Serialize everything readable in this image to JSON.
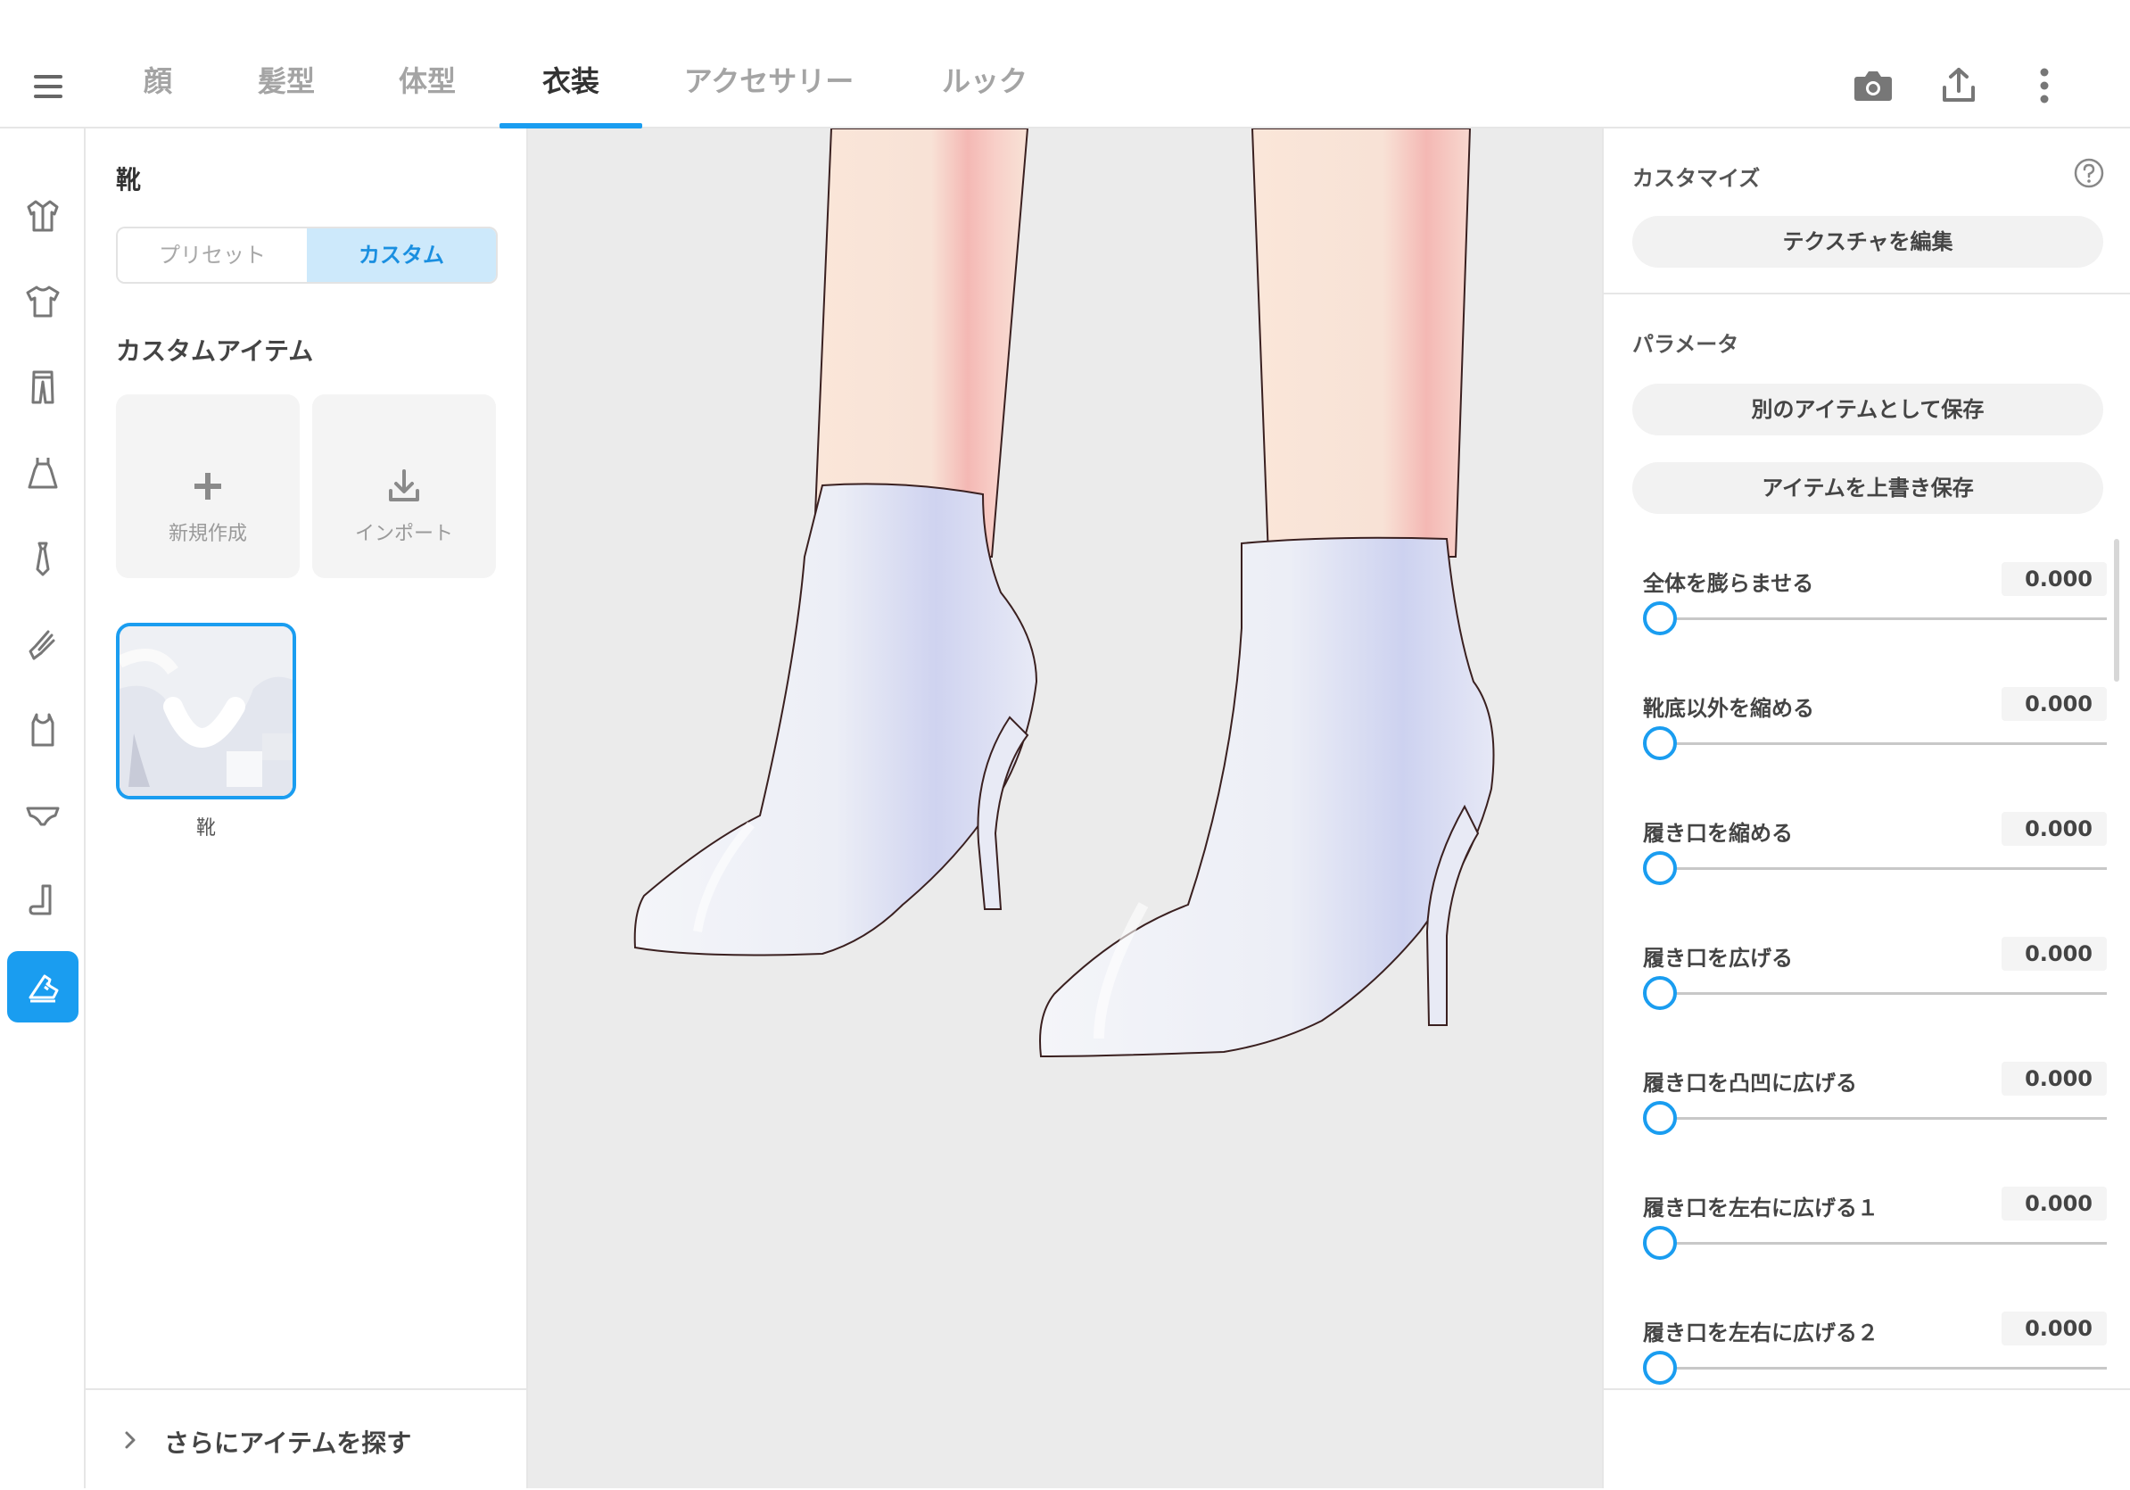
{
  "tabs": [
    {
      "label": "顔",
      "active": false
    },
    {
      "label": "髪型",
      "active": false
    },
    {
      "label": "体型",
      "active": false
    },
    {
      "label": "衣装",
      "active": true
    },
    {
      "label": "アクセサリー",
      "active": false
    },
    {
      "label": "ルック",
      "active": false
    }
  ],
  "top_icons": [
    "camera-icon",
    "share-upload-icon",
    "more-vertical-icon"
  ],
  "rail_items": [
    {
      "icon": "jacket-icon",
      "active": false
    },
    {
      "icon": "tshirt-icon",
      "active": false
    },
    {
      "icon": "pants-icon",
      "active": false
    },
    {
      "icon": "dress-icon",
      "active": false
    },
    {
      "icon": "necktie-icon",
      "active": false
    },
    {
      "icon": "glove-icon",
      "active": false
    },
    {
      "icon": "tank-top-icon",
      "active": false
    },
    {
      "icon": "underwear-icon",
      "active": false
    },
    {
      "icon": "sock-icon",
      "active": false
    },
    {
      "icon": "shoe-icon",
      "active": true
    }
  ],
  "left_panel": {
    "title": "靴",
    "segment": {
      "preset": "プリセット",
      "custom": "カスタム",
      "selected": "custom"
    },
    "custom_heading": "カスタムアイテム",
    "new_label": "新規作成",
    "import_label": "インポート",
    "item_label": "靴",
    "find_more": "さらにアイテムを探す"
  },
  "right_panel": {
    "customize_title": "カスタマイズ",
    "edit_texture": "テクスチャを編集",
    "params_title": "パラメータ",
    "save_as_new": "別のアイテムとして保存",
    "overwrite_save": "アイテムを上書き保存",
    "params": [
      {
        "label": "全体を膨らませる",
        "value": "0.000",
        "fraction": 0
      },
      {
        "label": "靴底以外を縮める",
        "value": "0.000",
        "fraction": 0
      },
      {
        "label": "履き口を縮める",
        "value": "0.000",
        "fraction": 0
      },
      {
        "label": "履き口を広げる",
        "value": "0.000",
        "fraction": 0
      },
      {
        "label": "履き口を凸凹に広げる",
        "value": "0.000",
        "fraction": 0
      },
      {
        "label": "履き口を左右に広げる１",
        "value": "0.000",
        "fraction": 0
      },
      {
        "label": "履き口を左右に広げる２",
        "value": "0.000",
        "fraction": 0
      }
    ]
  },
  "colors": {
    "accent": "#1a9df0",
    "accent_light": "#cde9fb",
    "viewport_bg": "#ebebeb",
    "skin": "#f8e2d6",
    "boot": "#eef0f7"
  }
}
